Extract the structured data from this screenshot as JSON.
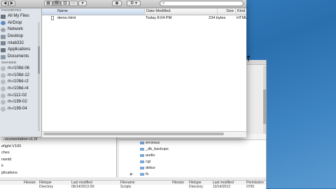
{
  "finder": {
    "toolbar": {
      "nav_back": "◀",
      "nav_forward": "▶",
      "view_icons": "▦",
      "view_list": "☰",
      "view_columns": "▥",
      "view_coverflow": "▭",
      "view_more": "▾",
      "eye_label": "◉",
      "action_label": "⚙ ▾",
      "search_placeholder": ""
    },
    "sidebar": {
      "favorites_header": "FAVORITES",
      "shared_header": "SHARED",
      "favorites": [
        {
          "label": "All My Files",
          "icon": "allfiles-icon"
        },
        {
          "label": "AirDrop",
          "icon": "airdrop-icon"
        },
        {
          "label": "Network",
          "icon": "network-icon"
        },
        {
          "label": "Desktop",
          "icon": "desktop-icon"
        },
        {
          "label": "mlab332",
          "icon": "home-icon"
        },
        {
          "label": "Applications",
          "icon": "applications-icon"
        },
        {
          "label": "Documents",
          "icon": "documents-icon"
        }
      ],
      "shared": [
        {
          "label": "m-r108d-06"
        },
        {
          "label": "m-r108d-12"
        },
        {
          "label": "m-r108d-r2"
        },
        {
          "label": "m-r108d-r4"
        },
        {
          "label": "m-r112-02"
        },
        {
          "label": "m-r199-02"
        },
        {
          "label": "m-r199-04"
        }
      ]
    },
    "columns": {
      "name": "Name",
      "date_modified": "Date Modified",
      "size": "Size",
      "kind": "Kind"
    },
    "files": [
      {
        "name": "demo.html",
        "date": "Today 8:04 PM",
        "size": "234 bytes",
        "kind": "HTML"
      }
    ]
  },
  "background_window": {
    "left_pane": [
      "...ocumentation-v1.0/",
      "efight-V100",
      "ches",
      "nwnld",
      "ir",
      "plications"
    ],
    "right_pane_header": "Filename",
    "right_pane_items": [
      {
        "label": "errorsus"
      },
      {
        "label": "_db_backups"
      },
      {
        "label": "audio"
      },
      {
        "label": "cgi"
      },
      {
        "label": "debur"
      },
      {
        "label": "fs"
      }
    ],
    "bottom_left_headers": [
      "Filesize",
      "Filetype",
      "Last modified"
    ],
    "bottom_left_values": [
      "",
      "Directory",
      "06/14/2013 09:"
    ],
    "bottom_right_headers": [
      "Filename",
      "Filesize",
      "Filetype",
      "Last modified",
      "Permission"
    ],
    "bottom_right_values": [
      "Scripts",
      "",
      "Directory",
      "10/14/2012",
      "0705"
    ]
  }
}
